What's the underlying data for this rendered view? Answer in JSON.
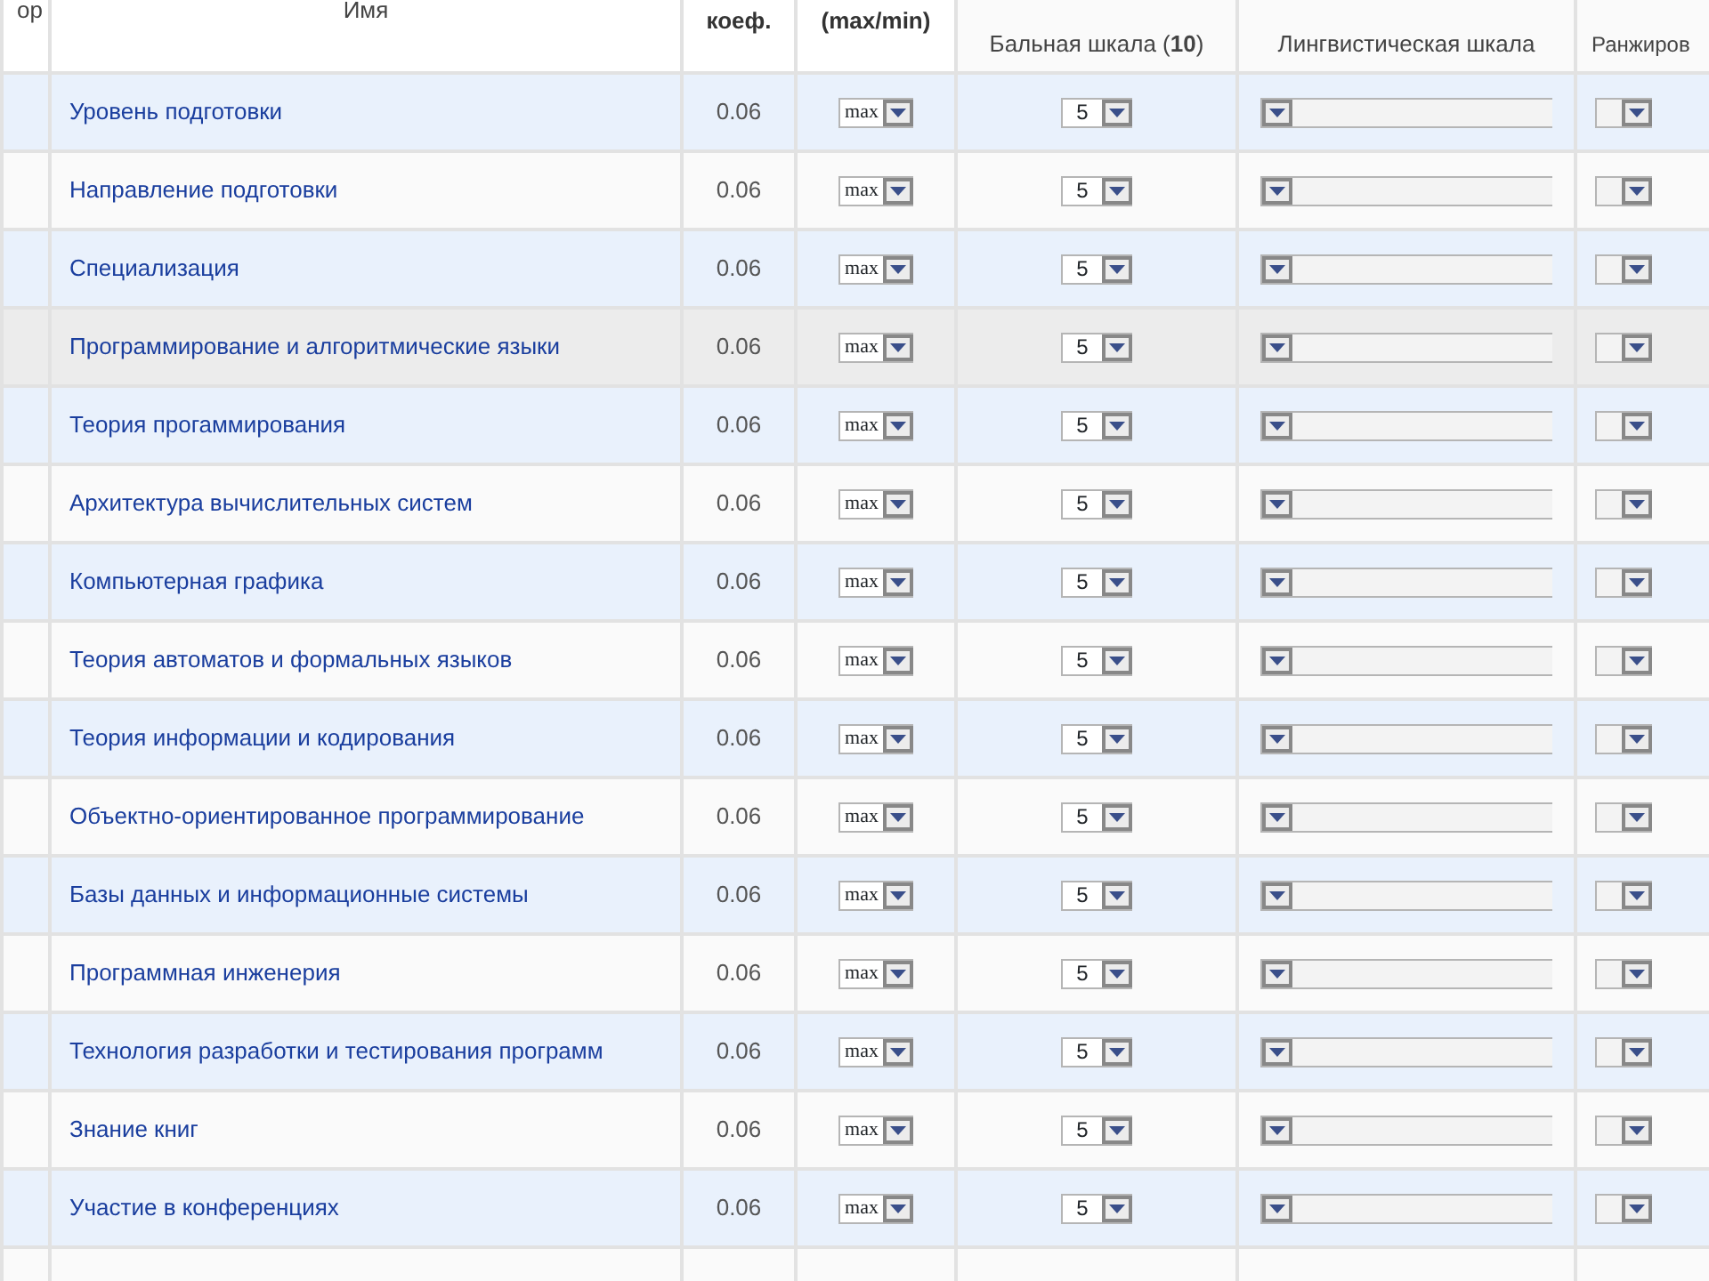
{
  "table": {
    "columns": [
      {
        "label": "ор",
        "kind": "plain"
      },
      {
        "label": "Имя",
        "kind": "plain"
      },
      {
        "label": "коеф.",
        "kind": "bold"
      },
      {
        "label": "(max/min)",
        "kind": "bold"
      },
      {
        "label": "Бальная шкала (**10**)",
        "kind": "sub"
      },
      {
        "label": "Лингвистическая шкала",
        "kind": "sub"
      },
      {
        "label": "Ранжиров",
        "kind": "sub"
      }
    ],
    "rows": [
      {
        "name": "Уровень подготовки",
        "coef": "0.06",
        "direction": "max",
        "score": "5",
        "highlighted": false
      },
      {
        "name": "Направление подготовки",
        "coef": "0.06",
        "direction": "max",
        "score": "5",
        "highlighted": false
      },
      {
        "name": "Специализация",
        "coef": "0.06",
        "direction": "max",
        "score": "5",
        "highlighted": false
      },
      {
        "name": "Программирование и алгоритмические языки",
        "coef": "0.06",
        "direction": "max",
        "score": "5",
        "highlighted": true
      },
      {
        "name": "Теория прогаммирования",
        "coef": "0.06",
        "direction": "max",
        "score": "5",
        "highlighted": false
      },
      {
        "name": "Архитектура вычислительных систем",
        "coef": "0.06",
        "direction": "max",
        "score": "5",
        "highlighted": false
      },
      {
        "name": "Компьютерная графика",
        "coef": "0.06",
        "direction": "max",
        "score": "5",
        "highlighted": false
      },
      {
        "name": "Теория автоматов и формальных языков",
        "coef": "0.06",
        "direction": "max",
        "score": "5",
        "highlighted": false
      },
      {
        "name": "Теория информации и кодирования",
        "coef": "0.06",
        "direction": "max",
        "score": "5",
        "highlighted": false
      },
      {
        "name": "Объектно-ориентированное программирование",
        "coef": "0.06",
        "direction": "max",
        "score": "5",
        "highlighted": false
      },
      {
        "name": "Базы данных и информационные системы",
        "coef": "0.06",
        "direction": "max",
        "score": "5",
        "highlighted": false
      },
      {
        "name": "Программная инженерия",
        "coef": "0.06",
        "direction": "max",
        "score": "5",
        "highlighted": false
      },
      {
        "name": "Технология разработки и тестирования программ",
        "coef": "0.06",
        "direction": "max",
        "score": "5",
        "highlighted": false
      },
      {
        "name": "Знание книг",
        "coef": "0.06",
        "direction": "max",
        "score": "5",
        "highlighted": false
      },
      {
        "name": "Участие в конференциях",
        "coef": "0.06",
        "direction": "max",
        "score": "5",
        "highlighted": false
      }
    ]
  }
}
